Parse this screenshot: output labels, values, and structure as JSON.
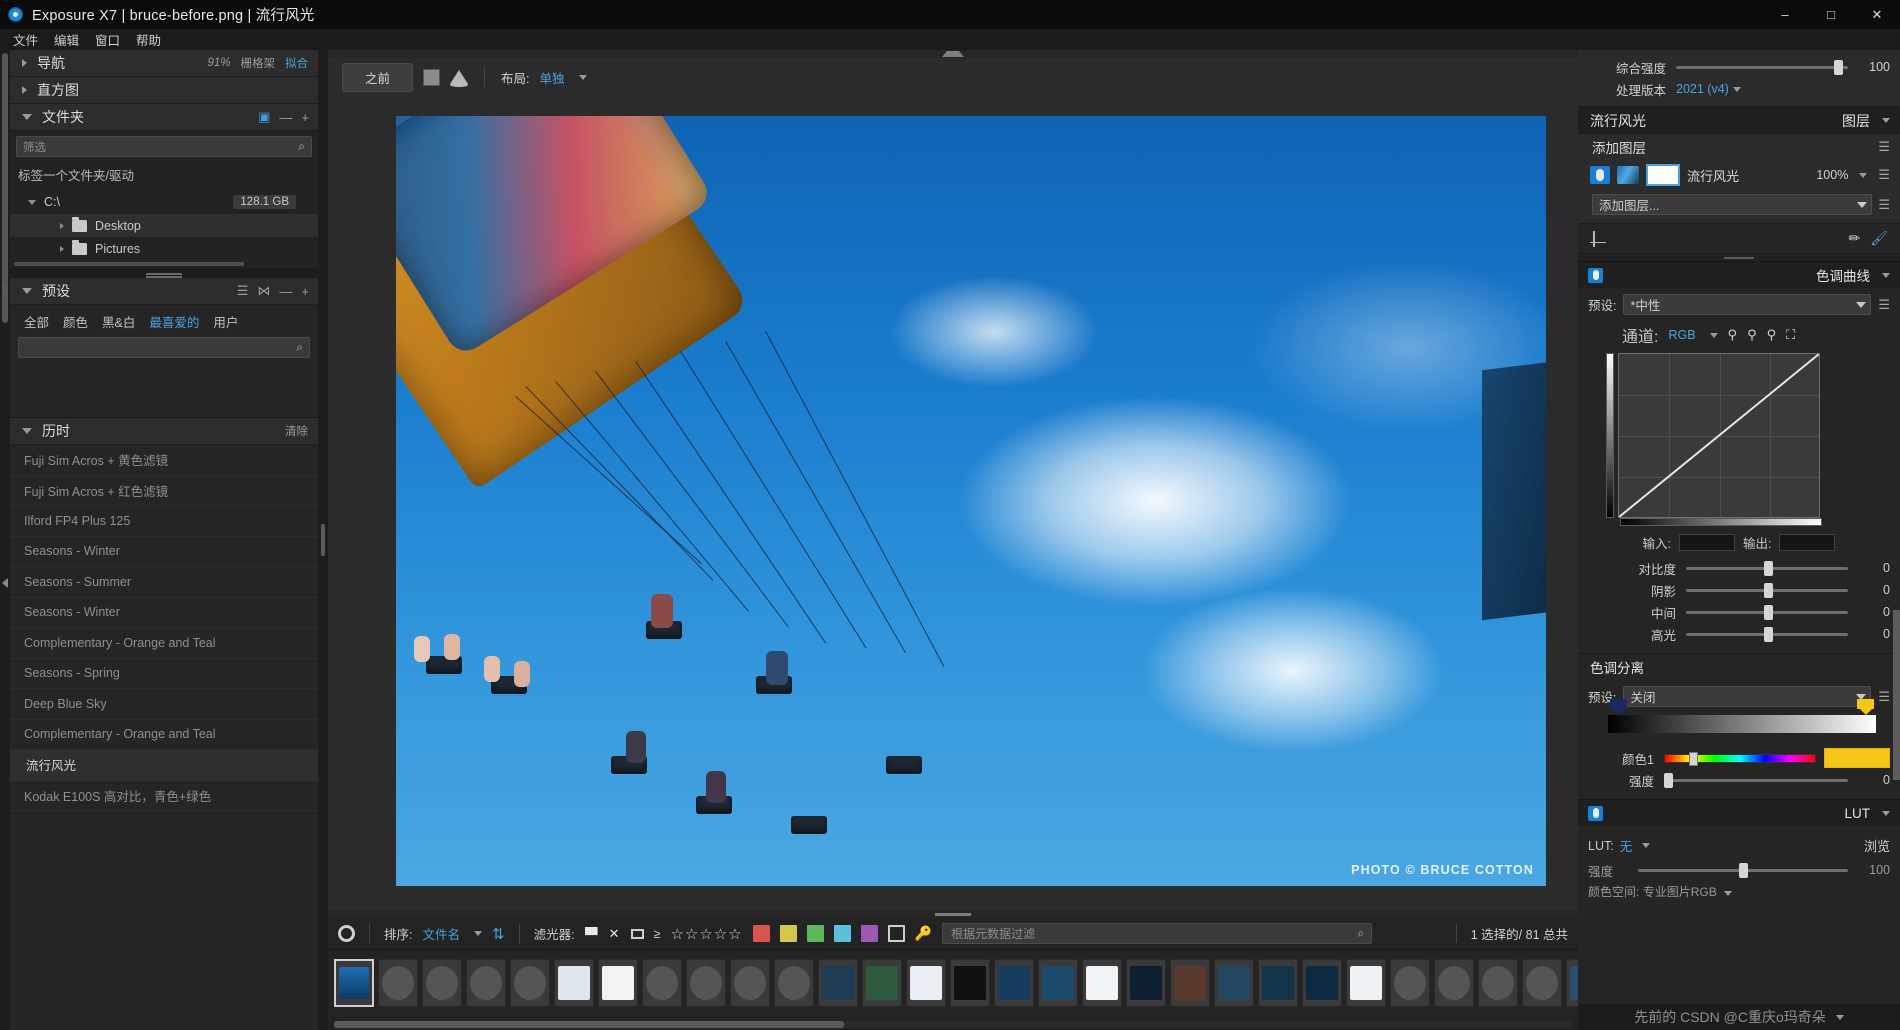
{
  "window": {
    "title": "Exposure X7 | bruce-before.png | 流行风光",
    "minimize": "–",
    "maximize": "□",
    "close": "✕"
  },
  "menu": {
    "items": [
      "文件",
      "编辑",
      "窗口",
      "帮助"
    ]
  },
  "left_panel": {
    "navigator": {
      "title": "导航",
      "zoom": "91%",
      "option_a": "栅格架",
      "option_b": "拟合"
    },
    "histogram": {
      "title": "直方图"
    },
    "folders": {
      "title": "文件夹",
      "filter_placeholder": "筛选",
      "label_hint": "标签一个文件夹/驱动",
      "drive": {
        "name": "C:\\",
        "capacity": "128.1 GB"
      },
      "tree": [
        {
          "label": "Desktop"
        },
        {
          "label": "Pictures"
        }
      ]
    },
    "presets": {
      "title": "预设",
      "tabs": [
        "全部",
        "颜色",
        "黑&白",
        "最喜爱的",
        "用户"
      ],
      "active_tab": "最喜爱的",
      "search_placeholder": ""
    },
    "history": {
      "title": "历时",
      "clear_label": "清除",
      "items": [
        {
          "label": "Fuji Sim Acros + 黄色滤镜"
        },
        {
          "label": "Fuji Sim Acros + 红色滤镜"
        },
        {
          "label": "Ilford FP4 Plus 125"
        },
        {
          "label": "Seasons - Winter"
        },
        {
          "label": "Seasons - Summer"
        },
        {
          "label": "Seasons - Winter"
        },
        {
          "label": "Complementary - Orange and Teal"
        },
        {
          "label": "Seasons - Spring"
        },
        {
          "label": "Deep Blue Sky"
        },
        {
          "label": "Complementary - Orange and Teal"
        },
        {
          "label": "流行风光"
        },
        {
          "label": "Kodak E100S 高对比，青色+绿色"
        }
      ],
      "selected_index": 10
    }
  },
  "viewer": {
    "before_button": "之前",
    "layout_label": "布局:",
    "layout_value": "单独",
    "watermark": "PHOTO © BRUCE COTTON"
  },
  "right_panel": {
    "overall_strength": {
      "label": "综合强度",
      "value": "100"
    },
    "process_version": {
      "label": "处理版本",
      "value": "2021 (v4)"
    },
    "layers_header": {
      "name": "流行风光",
      "title": "图层"
    },
    "add_layer_label": "添加图层",
    "layer_item": {
      "name": "流行风光",
      "opacity": "100%"
    },
    "add_layer_select": "添加图层...",
    "tone_curve": {
      "title": "色调曲线",
      "preset_label": "预设:",
      "preset_value": "*中性",
      "channel_label": "通道:",
      "channel_value": "RGB",
      "input_label": "输入:",
      "output_label": "输出:",
      "input_value": "",
      "output_value": "",
      "sliders": [
        {
          "label": "对比度",
          "value": "0"
        },
        {
          "label": "阴影",
          "value": "0"
        },
        {
          "label": "中间",
          "value": "0"
        },
        {
          "label": "高光",
          "value": "0"
        }
      ]
    },
    "split_tone": {
      "title": "色调分离",
      "preset_label": "预设:",
      "preset_value": "关闭",
      "color_label": "颜色1",
      "strength_label": "强度",
      "strength_value": "0",
      "swatch_color": "#f5c518",
      "shadow_marker_color": "#1a2a5e",
      "highlight_marker_color": "#f5c518"
    },
    "lut": {
      "title": "LUT",
      "lut_label": "LUT:",
      "lut_value": "无",
      "browse_label": "浏览",
      "strength_label": "强度",
      "strength_value": "100",
      "colorspace_label": "颜色空间:",
      "colorspace_value": "专业图片RGB"
    }
  },
  "filmstrip": {
    "sort_label": "排序:",
    "sort_value": "文件名",
    "filter_label": "滤光器:",
    "rating_prefix": "≥",
    "stars": "☆☆☆☆☆",
    "color_chips": [
      "#d9534f",
      "#d4c84a",
      "#5cb85c",
      "#5bc0de",
      "#9b59b6"
    ],
    "metadata_placeholder": "根据元数据过滤",
    "count_text": "1 选择的/ 81 总共"
  },
  "watermark_bar": {
    "text": "先前的 CSDN @C重庆o玛奇朵"
  },
  "colors": {
    "accent": "#4aa3df",
    "panel_bg": "#252525",
    "header_bg": "#1f1f1f"
  }
}
